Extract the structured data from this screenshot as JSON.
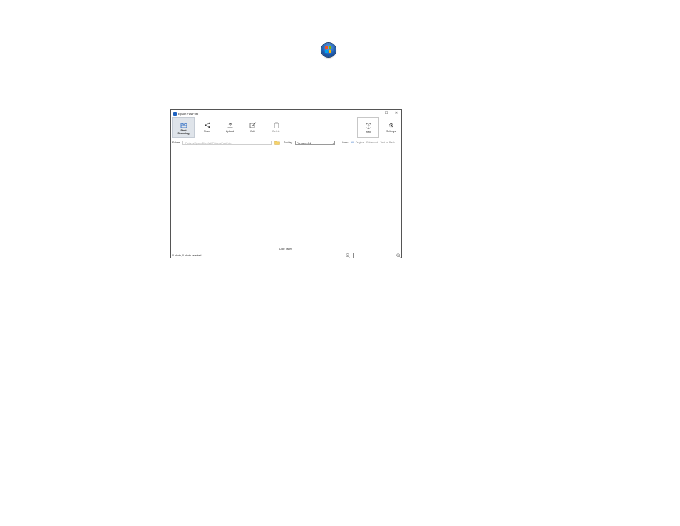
{
  "desktop": {
    "start_icon": "windows-start-orb"
  },
  "window": {
    "title": "Epson FastFoto",
    "controls": {
      "minimize": "—",
      "maximize": "☐",
      "close": "✕"
    }
  },
  "toolbar": {
    "start_scanning": {
      "label_line1": "Start",
      "label_line2": "Scanning",
      "icon": "scanner-icon"
    },
    "share": {
      "label": "Share",
      "icon": "share-icon"
    },
    "upload": {
      "label": "Upload",
      "icon": "upload-icon"
    },
    "edit": {
      "label": "Edit",
      "icon": "edit-icon"
    },
    "delete": {
      "label": "Delete",
      "icon": "trash-icon"
    },
    "help": {
      "label": "Help",
      "icon": "help-icon"
    },
    "settings": {
      "label": "Settings",
      "icon": "gear-icon"
    }
  },
  "folder": {
    "label": "Folder:",
    "value": "\\Pictures\\Epson Direct\\all\\Pictures\\FastFoto"
  },
  "sort": {
    "label": "Sort by:",
    "selected": "File name A-Z"
  },
  "view": {
    "label": "View:",
    "options": [
      "All",
      "Original",
      "Enhanced",
      "Text on Back"
    ],
    "selected_index": 0
  },
  "right_pane": {
    "date_taken_label": "Date Taken"
  },
  "status": {
    "text": "0 photo, 0 photo selected"
  },
  "colors": {
    "accent": "#1e62c0",
    "border": "#555555"
  }
}
